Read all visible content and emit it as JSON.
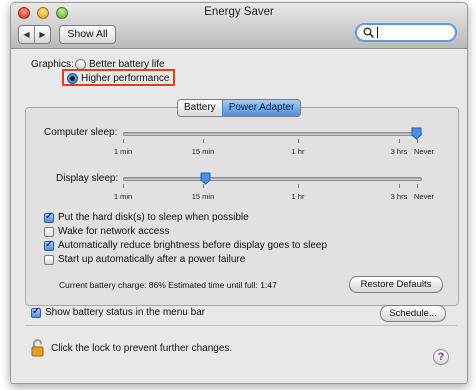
{
  "window": {
    "title": "Energy Saver",
    "traffic_lights": [
      "close",
      "minimize",
      "zoom"
    ]
  },
  "toolbar": {
    "back_icon": "chevron-left-icon",
    "forward_icon": "chevron-right-icon",
    "show_all_label": "Show All",
    "search_value": "",
    "search_icon": "search-icon"
  },
  "graphics": {
    "label": "Graphics:",
    "options": [
      {
        "label": "Better battery life",
        "selected": false
      },
      {
        "label": "Higher performance",
        "selected": true
      }
    ],
    "highlight_color": "#e0401f"
  },
  "tabs": [
    {
      "label": "Battery",
      "active": false
    },
    {
      "label": "Power Adapter",
      "active": true
    }
  ],
  "sliders": {
    "computer_sleep": {
      "label": "Computer sleep:",
      "value": "Never",
      "ticks": [
        "1 min",
        "15 min",
        "1 hr",
        "3 hrs",
        "Never"
      ]
    },
    "display_sleep": {
      "label": "Display sleep:",
      "value": "15 min",
      "ticks": [
        "1 min",
        "15 min",
        "1 hr",
        "3 hrs",
        "Never"
      ]
    }
  },
  "options": [
    {
      "label": "Put the hard disk(s) to sleep when possible",
      "checked": true
    },
    {
      "label": "Wake for network access",
      "checked": false
    },
    {
      "label": "Automatically reduce brightness before display goes to sleep",
      "checked": true
    },
    {
      "label": "Start up automatically after a power failure",
      "checked": false
    }
  ],
  "status": {
    "charge_text": "Current battery charge: 86%  Estimated time until full: 1:47",
    "restore_label": "Restore Defaults"
  },
  "footer": {
    "show_battery_label": "Show battery status in the menu bar",
    "show_battery_checked": true,
    "schedule_label": "Schedule...",
    "lock_text": "Click the lock to prevent further changes.",
    "lock_icon": "unlocked-padlock-icon",
    "help_label": "?"
  },
  "colors": {
    "accent": "#4b8fe4",
    "window_bg": "#e8e8e8"
  }
}
